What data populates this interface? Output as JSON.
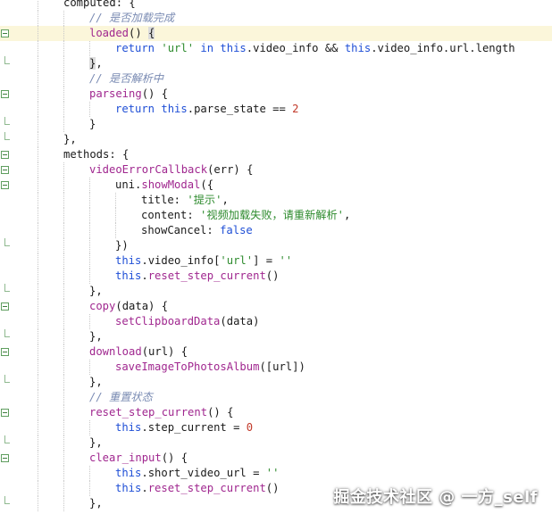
{
  "editor": {
    "colors": {
      "background": "#ffffff",
      "current_line": "#fbf6da",
      "keyword": "#1f4fd6",
      "function": "#a0278f",
      "string": "#2e8b2e",
      "number": "#c23a2a",
      "comment": "#7a8bb3",
      "fold_marker": "#5f9e5f"
    },
    "lines": [
      {
        "indent": 2,
        "fold": "",
        "tokens": [
          {
            "t": "computed: {",
            "c": "plain"
          }
        ]
      },
      {
        "indent": 3,
        "fold": "",
        "tokens": [
          {
            "t": "// 是否加载完成",
            "c": "cmt"
          }
        ]
      },
      {
        "indent": 3,
        "fold": "open",
        "highlight": true,
        "tokens": [
          {
            "t": "loaded",
            "c": "fn"
          },
          {
            "t": "() ",
            "c": "plain"
          },
          {
            "t": "{",
            "c": "sel"
          }
        ]
      },
      {
        "indent": 4,
        "fold": "",
        "tokens": [
          {
            "t": "return ",
            "c": "kw"
          },
          {
            "t": "'url'",
            "c": "str"
          },
          {
            "t": " in ",
            "c": "kw"
          },
          {
            "t": "this",
            "c": "kw"
          },
          {
            "t": ".video_info && ",
            "c": "plain"
          },
          {
            "t": "this",
            "c": "kw"
          },
          {
            "t": ".video_info.url.length",
            "c": "plain"
          }
        ]
      },
      {
        "indent": 3,
        "fold": "end",
        "tokens": [
          {
            "t": "}",
            "c": "sel"
          },
          {
            "t": ",",
            "c": "plain"
          }
        ]
      },
      {
        "indent": 3,
        "fold": "",
        "tokens": [
          {
            "t": "// 是否解析中",
            "c": "cmt"
          }
        ]
      },
      {
        "indent": 3,
        "fold": "open",
        "tokens": [
          {
            "t": "parseing",
            "c": "fn"
          },
          {
            "t": "() {",
            "c": "plain"
          }
        ]
      },
      {
        "indent": 4,
        "fold": "",
        "tokens": [
          {
            "t": "return ",
            "c": "kw"
          },
          {
            "t": "this",
            "c": "kw"
          },
          {
            "t": ".parse_state == ",
            "c": "plain"
          },
          {
            "t": "2",
            "c": "num"
          }
        ]
      },
      {
        "indent": 3,
        "fold": "end",
        "tokens": [
          {
            "t": "}",
            "c": "plain"
          }
        ]
      },
      {
        "indent": 2,
        "fold": "end",
        "tokens": [
          {
            "t": "},",
            "c": "plain"
          }
        ]
      },
      {
        "indent": 2,
        "fold": "open",
        "tokens": [
          {
            "t": "methods: {",
            "c": "plain"
          }
        ]
      },
      {
        "indent": 3,
        "fold": "open",
        "tokens": [
          {
            "t": "videoErrorCallback",
            "c": "fn"
          },
          {
            "t": "(err) {",
            "c": "plain"
          }
        ]
      },
      {
        "indent": 4,
        "fold": "open",
        "tokens": [
          {
            "t": "uni.",
            "c": "plain"
          },
          {
            "t": "showModal",
            "c": "fn"
          },
          {
            "t": "({",
            "c": "plain"
          }
        ]
      },
      {
        "indent": 5,
        "fold": "",
        "tokens": [
          {
            "t": "title: ",
            "c": "plain"
          },
          {
            "t": "'提示'",
            "c": "str"
          },
          {
            "t": ",",
            "c": "plain"
          }
        ]
      },
      {
        "indent": 5,
        "fold": "",
        "tokens": [
          {
            "t": "content: ",
            "c": "plain"
          },
          {
            "t": "'视频加载失败，请重新解析'",
            "c": "str"
          },
          {
            "t": ",",
            "c": "plain"
          }
        ]
      },
      {
        "indent": 5,
        "fold": "",
        "tokens": [
          {
            "t": "showCancel: ",
            "c": "plain"
          },
          {
            "t": "false",
            "c": "kw"
          }
        ]
      },
      {
        "indent": 4,
        "fold": "end",
        "tokens": [
          {
            "t": "})",
            "c": "plain"
          }
        ]
      },
      {
        "indent": 4,
        "fold": "",
        "tokens": [
          {
            "t": "this",
            "c": "kw"
          },
          {
            "t": ".video_info[",
            "c": "plain"
          },
          {
            "t": "'url'",
            "c": "str"
          },
          {
            "t": "] = ",
            "c": "plain"
          },
          {
            "t": "''",
            "c": "str"
          }
        ]
      },
      {
        "indent": 4,
        "fold": "",
        "tokens": [
          {
            "t": "this",
            "c": "kw"
          },
          {
            "t": ".",
            "c": "plain"
          },
          {
            "t": "reset_step_current",
            "c": "fn"
          },
          {
            "t": "()",
            "c": "plain"
          }
        ]
      },
      {
        "indent": 3,
        "fold": "end",
        "tokens": [
          {
            "t": "},",
            "c": "plain"
          }
        ]
      },
      {
        "indent": 3,
        "fold": "open",
        "tokens": [
          {
            "t": "copy",
            "c": "fn"
          },
          {
            "t": "(data) {",
            "c": "plain"
          }
        ]
      },
      {
        "indent": 4,
        "fold": "",
        "tokens": [
          {
            "t": "setClipboardData",
            "c": "fn"
          },
          {
            "t": "(data)",
            "c": "plain"
          }
        ]
      },
      {
        "indent": 3,
        "fold": "end",
        "tokens": [
          {
            "t": "},",
            "c": "plain"
          }
        ]
      },
      {
        "indent": 3,
        "fold": "open",
        "tokens": [
          {
            "t": "download",
            "c": "fn"
          },
          {
            "t": "(url) {",
            "c": "plain"
          }
        ]
      },
      {
        "indent": 4,
        "fold": "",
        "tokens": [
          {
            "t": "saveImageToPhotosAlbum",
            "c": "fn"
          },
          {
            "t": "([url])",
            "c": "plain"
          }
        ]
      },
      {
        "indent": 3,
        "fold": "end",
        "tokens": [
          {
            "t": "},",
            "c": "plain"
          }
        ]
      },
      {
        "indent": 3,
        "fold": "",
        "tokens": [
          {
            "t": "// 重置状态",
            "c": "cmt"
          }
        ]
      },
      {
        "indent": 3,
        "fold": "open",
        "tokens": [
          {
            "t": "reset_step_current",
            "c": "fn"
          },
          {
            "t": "() {",
            "c": "plain"
          }
        ]
      },
      {
        "indent": 4,
        "fold": "",
        "tokens": [
          {
            "t": "this",
            "c": "kw"
          },
          {
            "t": ".step_current = ",
            "c": "plain"
          },
          {
            "t": "0",
            "c": "num"
          }
        ]
      },
      {
        "indent": 3,
        "fold": "end",
        "tokens": [
          {
            "t": "},",
            "c": "plain"
          }
        ]
      },
      {
        "indent": 3,
        "fold": "open",
        "tokens": [
          {
            "t": "clear_input",
            "c": "fn"
          },
          {
            "t": "() {",
            "c": "plain"
          }
        ]
      },
      {
        "indent": 4,
        "fold": "",
        "tokens": [
          {
            "t": "this",
            "c": "kw"
          },
          {
            "t": ".short_video_url = ",
            "c": "plain"
          },
          {
            "t": "''",
            "c": "str"
          }
        ]
      },
      {
        "indent": 4,
        "fold": "",
        "tokens": [
          {
            "t": "this",
            "c": "kw"
          },
          {
            "t": ".",
            "c": "plain"
          },
          {
            "t": "reset_step_current",
            "c": "fn"
          },
          {
            "t": "()",
            "c": "plain"
          }
        ]
      },
      {
        "indent": 3,
        "fold": "end",
        "tokens": [
          {
            "t": "},",
            "c": "plain"
          }
        ]
      }
    ]
  },
  "watermark": {
    "text": "掘金技术社区 @ 一方_self"
  }
}
